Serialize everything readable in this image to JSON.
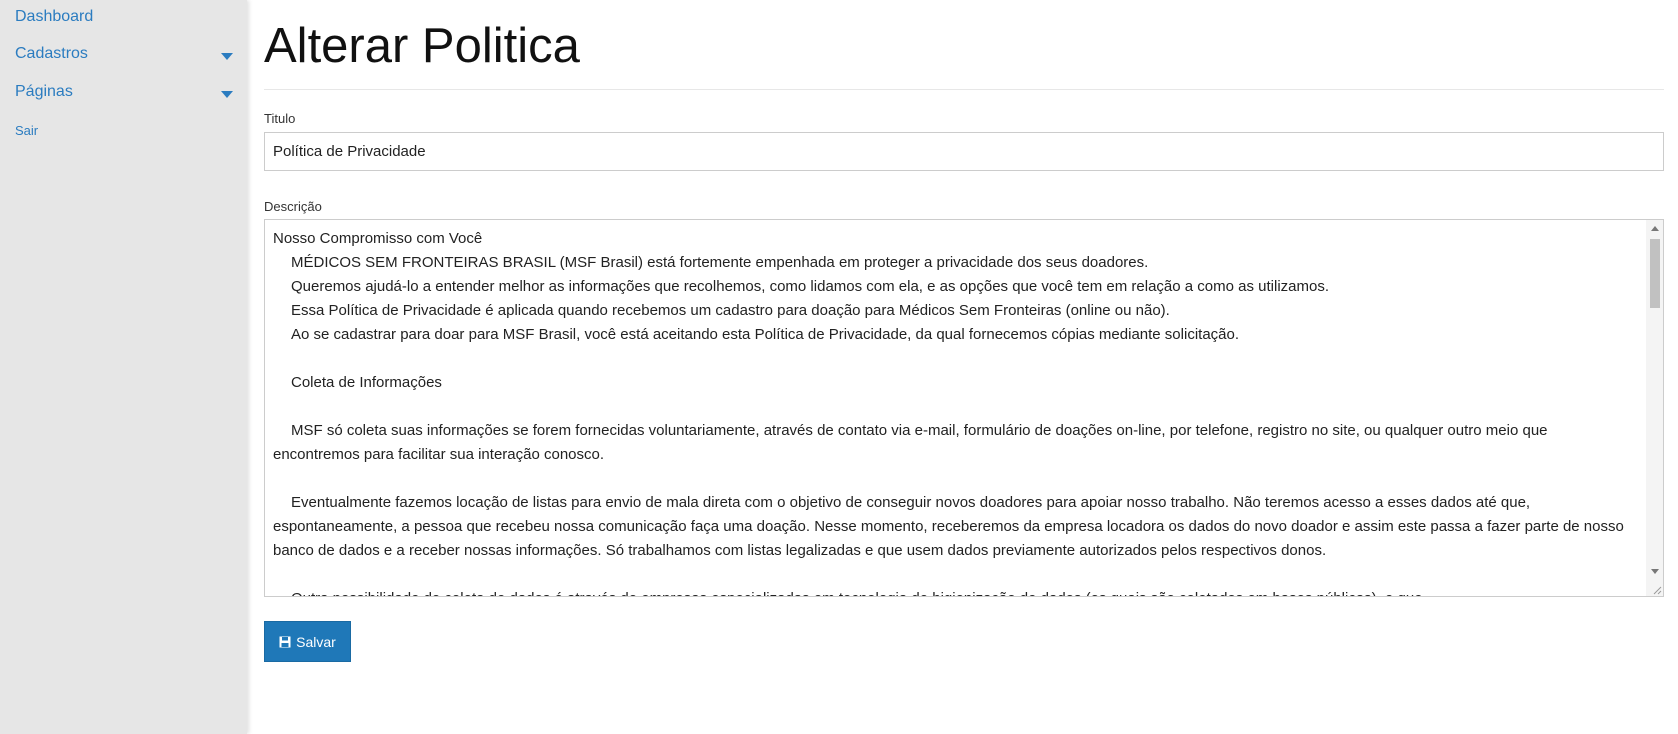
{
  "sidebar": {
    "items": [
      {
        "label": "Dashboard"
      },
      {
        "label": "Cadastros",
        "icon": "caret-down-icon"
      },
      {
        "label": "Páginas",
        "icon": "caret-down-icon"
      },
      {
        "label": "Sair"
      }
    ]
  },
  "main": {
    "title": "Alterar Politica",
    "fields": {
      "titulo_label": "Titulo",
      "titulo_value": "Política de Privacidade",
      "descricao_label": "Descrição",
      "descricao_lines": [
        "Nosso Compromisso com Você",
        "MÉDICOS SEM FRONTEIRAS BRASIL (MSF Brasil) está fortemente empenhada em proteger a privacidade dos seus doadores.",
        "Queremos ajudá-lo a entender melhor as informações que recolhemos, como lidamos com ela, e as opções que você tem em relação a como as utilizamos.",
        "Essa Política de Privacidade é aplicada quando recebemos um cadastro para doação para Médicos Sem Fronteiras (online ou não).",
        "Ao se cadastrar para doar para MSF Brasil, você está aceitando esta Política de Privacidade, da qual fornecemos cópias mediante solicitação.",
        "",
        "Coleta de Informações",
        "",
        "MSF só coleta suas informações se forem fornecidas voluntariamente, através de contato via e-mail, formulário de doações on-line, por telefone, registro no site, ou qualquer outro meio que encontremos para facilitar sua interação conosco.",
        "",
        "Eventualmente fazemos locação de listas para envio de mala direta com o objetivo de conseguir novos doadores para apoiar nosso trabalho. Não teremos acesso a esses dados até que, espontaneamente, a pessoa que recebeu nossa comunicação faça uma doação. Nesse momento, receberemos da empresa locadora os dados do novo doador e assim este passa a fazer parte de nosso banco de dados e a receber nossas informações. Só trabalhamos com listas legalizadas e que usem dados previamente autorizados pelos respectivos donos.",
        "",
        "Outra possibilidade de coleta de dados é através de empresas especializadas em tecnologia de higienização de dados (os quais são coletados em bases públicas), e que"
      ]
    },
    "save_label": "Salvar",
    "accent_color": "#1f78b8"
  }
}
